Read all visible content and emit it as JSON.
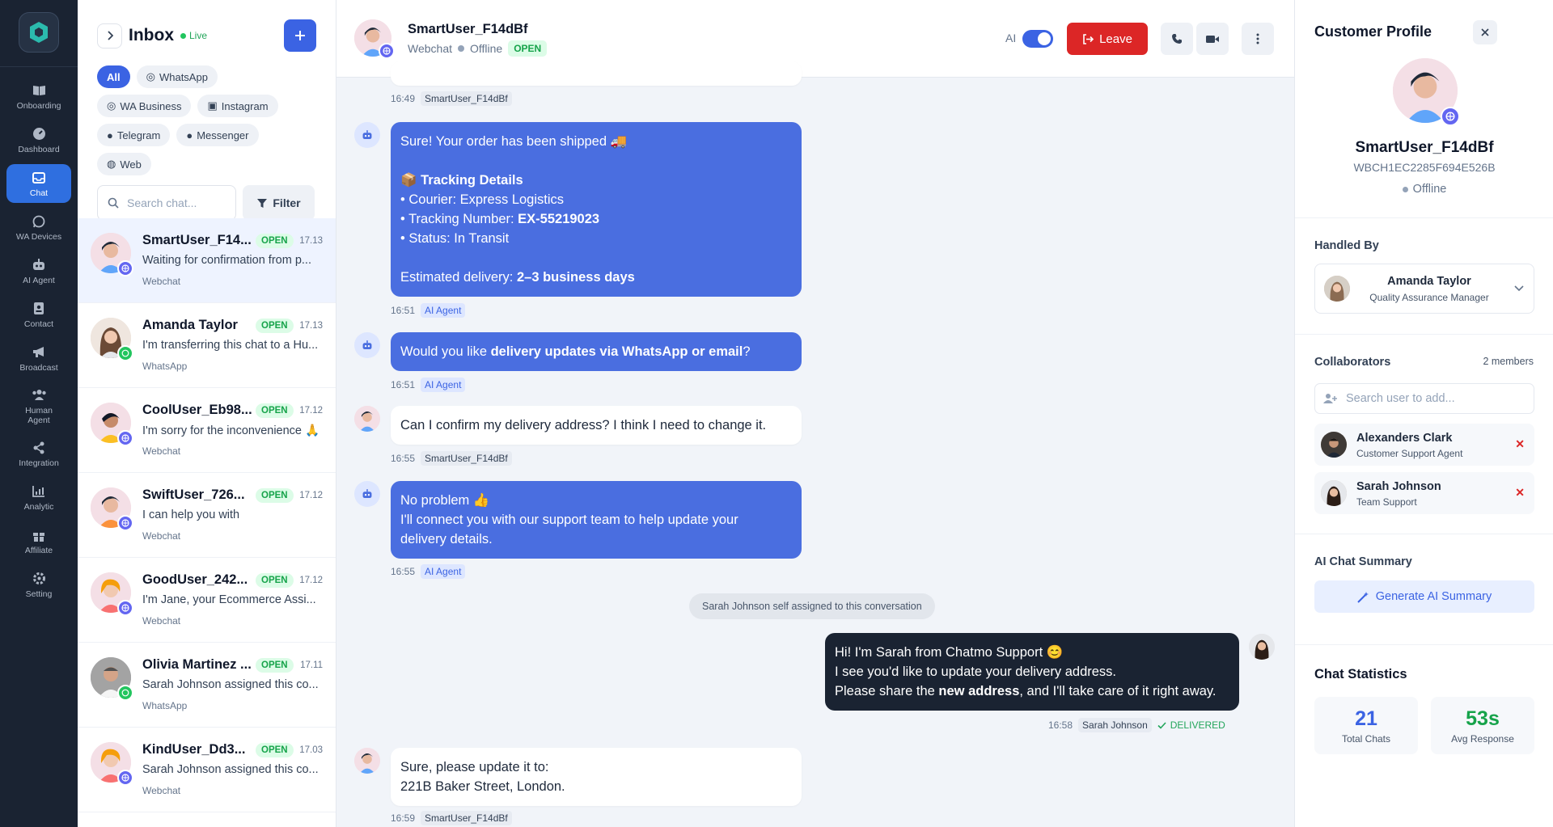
{
  "nav": {
    "items": [
      {
        "label": "Onboarding",
        "icon": "book-open-icon"
      },
      {
        "label": "Dashboard",
        "icon": "gauge-icon"
      },
      {
        "label": "Chat",
        "icon": "inbox-icon",
        "active": true
      },
      {
        "label": "WA Devices",
        "icon": "whatsapp-icon"
      },
      {
        "label": "AI Agent",
        "icon": "robot-icon"
      },
      {
        "label": "Contact",
        "icon": "contact-book-icon"
      },
      {
        "label": "Broadcast",
        "icon": "megaphone-icon"
      },
      {
        "label": "Human Agent",
        "icon": "users-icon"
      },
      {
        "label": "Integration",
        "icon": "share-nodes-icon"
      },
      {
        "label": "Analytic",
        "icon": "bar-chart-icon"
      },
      {
        "label": "Affiliate",
        "icon": "gift-icon"
      },
      {
        "label": "Setting",
        "icon": "gear-icon"
      }
    ]
  },
  "inbox": {
    "title": "Inbox",
    "live_label": "Live",
    "filters": [
      "All",
      "WhatsApp",
      "WA Business",
      "Instagram",
      "Telegram",
      "Messenger",
      "Web"
    ],
    "search_placeholder": "Search chat...",
    "filter_label": "Filter",
    "chats": [
      {
        "name": "SmartUser_F14...",
        "status": "OPEN",
        "time": "17.13",
        "preview": "Waiting for confirmation from p...",
        "channel": "Webchat",
        "active": true
      },
      {
        "name": "Amanda Taylor",
        "status": "OPEN",
        "time": "17.13",
        "preview": "I'm transferring this chat to a Hu...",
        "channel": "WhatsApp"
      },
      {
        "name": "CoolUser_Eb98...",
        "status": "OPEN",
        "time": "17.12",
        "preview": "I'm sorry for the inconvenience 🙏",
        "channel": "Webchat"
      },
      {
        "name": "SwiftUser_726...",
        "status": "OPEN",
        "time": "17.12",
        "preview": "I can help you with",
        "channel": "Webchat"
      },
      {
        "name": "GoodUser_242...",
        "status": "OPEN",
        "time": "17.12",
        "preview": "I'm Jane, your Ecommerce Assi...",
        "channel": "Webchat"
      },
      {
        "name": "Olivia Martinez ...",
        "status": "OPEN",
        "time": "17.11",
        "preview": "Sarah Johnson assigned this co...",
        "channel": "WhatsApp"
      },
      {
        "name": "KindUser_Dd3...",
        "status": "OPEN",
        "time": "17.03",
        "preview": "Sarah Johnson assigned this co...",
        "channel": "Webchat"
      }
    ]
  },
  "chat": {
    "header": {
      "name": "SmartUser_F14dBf",
      "channel": "Webchat",
      "presence": "Offline",
      "status": "OPEN",
      "ai_label": "AI",
      "ai_enabled": true,
      "leave_label": "Leave"
    },
    "messages": [
      {
        "time": "16:49",
        "sender": "SmartUser_F14dBf"
      },
      {
        "line1": "Sure! Your order has been shipped 🚚",
        "line2_bold": "📦 Tracking Details",
        "line3": "• Courier: Express Logistics",
        "line4_pre": "• Tracking Number: ",
        "line4_bold": "EX-55219023",
        "line5": "• Status: In Transit",
        "line6_pre": "Estimated delivery: ",
        "line6_bold": "2–3 business days",
        "time": "16:51",
        "sender": "AI Agent"
      },
      {
        "pre": "Would you like ",
        "bold": "delivery updates via WhatsApp or email",
        "post": "?",
        "time": "16:51",
        "sender": "AI Agent"
      },
      {
        "text": "Can I confirm my delivery address? I think I need to change it.",
        "time": "16:55",
        "sender": "SmartUser_F14dBf"
      },
      {
        "line1": "No problem 👍",
        "line2": "I'll connect you with our support team to help update your",
        "line3": "delivery details.",
        "time": "16:55",
        "sender": "AI Agent"
      },
      {
        "system": "Sarah Johnson self assigned to this conversation"
      },
      {
        "line1": "Hi! I'm Sarah from Chatmo Support 😊",
        "line2": "I see you'd like to update your delivery address.",
        "line3_pre": "Please share the ",
        "line3_bold": "new address",
        "line3_post": ", and I'll take care of it right away.",
        "time": "16:58",
        "sender": "Sarah Johnson",
        "delivery": "DELIVERED"
      },
      {
        "line1": "Sure, please update it to:",
        "line2": "221B Baker Street, London.",
        "time": "16:59",
        "sender": "SmartUser_F14dBf"
      }
    ]
  },
  "profile": {
    "title": "Customer Profile",
    "name": "SmartUser_F14dBf",
    "id": "WBCH1EC2285F694E526B",
    "presence": "Offline",
    "handled_by_title": "Handled By",
    "handler": {
      "name": "Amanda Taylor",
      "role": "Quality Assurance Manager"
    },
    "collaborators_title": "Collaborators",
    "collaborators_count": "2 members",
    "collab_search_placeholder": "Search user to add...",
    "collaborators": [
      {
        "name": "Alexanders Clark",
        "role": "Customer Support Agent"
      },
      {
        "name": "Sarah Johnson",
        "role": "Team Support"
      }
    ],
    "summary_title": "AI Chat Summary",
    "summary_button": "Generate AI Summary",
    "stats_title": "Chat Statistics",
    "stats": [
      {
        "value": "21",
        "label": "Total Chats",
        "color": "#3b63e3"
      },
      {
        "value": "53s",
        "label": "Avg Response",
        "color": "#16a34a"
      }
    ]
  },
  "colors": {
    "primary": "#3b63e3",
    "danger": "#dc2626",
    "success": "#16a34a",
    "nav_bg": "#1a2332",
    "ai_bubble": "#4a6ee0"
  }
}
